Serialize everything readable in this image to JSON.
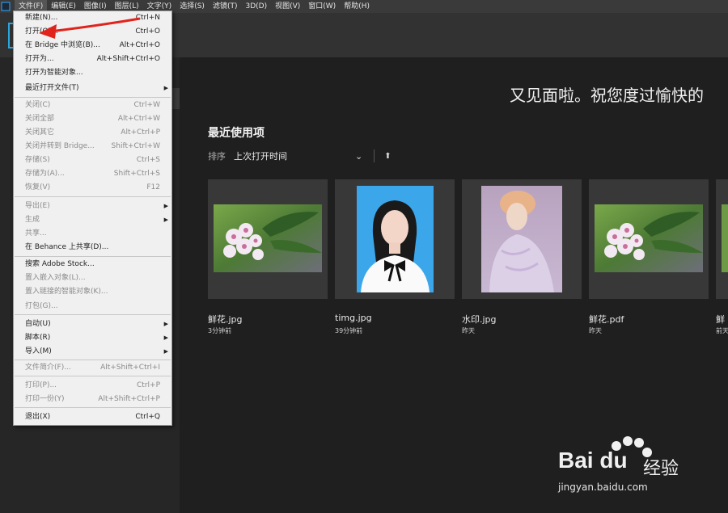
{
  "menubar": {
    "items": [
      "文件(F)",
      "编辑(E)",
      "图像(I)",
      "图层(L)",
      "文字(Y)",
      "选择(S)",
      "滤镜(T)",
      "3D(D)",
      "视图(V)",
      "窗口(W)",
      "帮助(H)"
    ]
  },
  "home": {
    "greeting": "又见面啦。祝您度过愉快的",
    "recent_title": "最近使用项",
    "sort_label": "排序",
    "sort_value": "上次打开时间"
  },
  "recent": [
    {
      "name": "鲜花.jpg",
      "time": "3分钟前"
    },
    {
      "name": "timg.jpg",
      "time": "39分钟前"
    },
    {
      "name": "水印.jpg",
      "time": "昨天"
    },
    {
      "name": "鲜花.pdf",
      "time": "昨天"
    },
    {
      "name": "鲜",
      "time": "前天"
    }
  ],
  "file_menu": {
    "items": [
      {
        "label": "新建(N)...",
        "shortcut": "Ctrl+N",
        "enabled": true
      },
      {
        "label": "打开(O)...",
        "shortcut": "Ctrl+O",
        "enabled": true
      },
      {
        "label": "在 Bridge 中浏览(B)...",
        "shortcut": "Alt+Ctrl+O",
        "enabled": true
      },
      {
        "label": "打开为...",
        "shortcut": "Alt+Shift+Ctrl+O",
        "enabled": true
      },
      {
        "label": "打开为智能对象...",
        "shortcut": "",
        "enabled": true
      },
      {
        "label": "最近打开文件(T)",
        "shortcut": "",
        "enabled": true
      },
      {
        "label": "关闭(C)",
        "shortcut": "Ctrl+W",
        "enabled": false
      },
      {
        "label": "关闭全部",
        "shortcut": "Alt+Ctrl+W",
        "enabled": false
      },
      {
        "label": "关闭其它",
        "shortcut": "Alt+Ctrl+P",
        "enabled": false
      },
      {
        "label": "关闭并转到 Bridge...",
        "shortcut": "Shift+Ctrl+W",
        "enabled": false
      },
      {
        "label": "存储(S)",
        "shortcut": "Ctrl+S",
        "enabled": false
      },
      {
        "label": "存储为(A)...",
        "shortcut": "Shift+Ctrl+S",
        "enabled": false
      },
      {
        "label": "恢复(V)",
        "shortcut": "F12",
        "enabled": false
      },
      {
        "label": "导出(E)",
        "shortcut": "",
        "enabled": false
      },
      {
        "label": "生成",
        "shortcut": "",
        "enabled": false
      },
      {
        "label": "共享...",
        "shortcut": "",
        "enabled": false
      },
      {
        "label": "在 Behance 上共享(D)...",
        "shortcut": "",
        "enabled": true
      },
      {
        "label": "搜索 Adobe Stock...",
        "shortcut": "",
        "enabled": true
      },
      {
        "label": "置入嵌入对象(L)...",
        "shortcut": "",
        "enabled": false
      },
      {
        "label": "置入链接的智能对象(K)...",
        "shortcut": "",
        "enabled": false
      },
      {
        "label": "打包(G)...",
        "shortcut": "",
        "enabled": false
      },
      {
        "label": "自动(U)",
        "shortcut": "",
        "enabled": true
      },
      {
        "label": "脚本(R)",
        "shortcut": "",
        "enabled": true
      },
      {
        "label": "导入(M)",
        "shortcut": "",
        "enabled": true
      },
      {
        "label": "文件简介(F)...",
        "shortcut": "Alt+Shift+Ctrl+I",
        "enabled": false
      },
      {
        "label": "打印(P)...",
        "shortcut": "Ctrl+P",
        "enabled": false
      },
      {
        "label": "打印一份(Y)",
        "shortcut": "Alt+Shift+Ctrl+P",
        "enabled": false
      },
      {
        "label": "退出(X)",
        "shortcut": "Ctrl+Q",
        "enabled": true
      }
    ]
  },
  "watermark": {
    "logo_text": "Bai du",
    "brand": "经验",
    "url": "jingyan.baidu.com"
  },
  "colors": {
    "accent": "#2aa6df",
    "annotation_arrow": "#e0231b"
  }
}
